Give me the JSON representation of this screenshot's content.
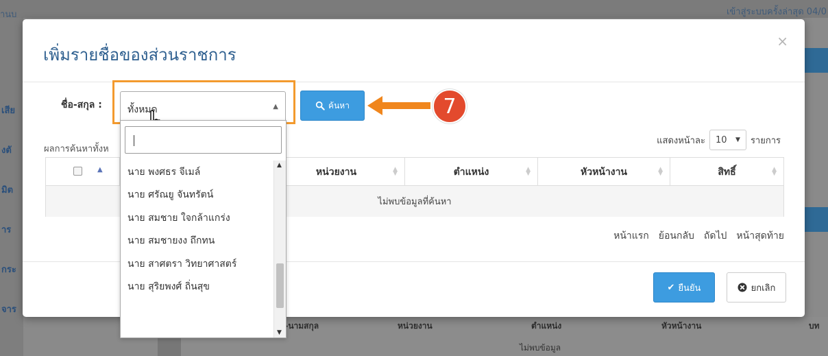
{
  "background": {
    "top_left_text": "านบ",
    "top_right_text": "เข้าสู่ระบบครั้งล่าสุด 04/0",
    "side_items": [
      "เสีย",
      "งตั",
      "มิต",
      "าร",
      "กระ",
      "จาร"
    ],
    "table_headers": [
      "ชื่อ-นามสกุล",
      "หน่วยงาน",
      "ตำแหน่ง",
      "หัวหน้างาน",
      "บท"
    ],
    "empty_text": "ไม่พบข้อมูล"
  },
  "modal": {
    "title": "เพิ่มรายชื่อของส่วนราชการ",
    "close": "×",
    "search_label": "ชื่อ-สกุล :",
    "select_value": "ทั้งหมด",
    "search_button": "ค้นหา",
    "step_number": "7",
    "results_label": "ผลการค้นหาทั้งห",
    "page_size_label": "แสดงหน้าละ",
    "page_size_value": "10",
    "page_size_suffix": "รายการ",
    "table": {
      "headers": [
        "หน่วยงาน",
        "ตำแหน่ง",
        "หัวหน้างาน",
        "สิทธิ์"
      ],
      "empty_text": "ไม่พบข้อมูลที่ค้นหา"
    },
    "pager": [
      "หน้าแรก",
      "ย้อนกลับ",
      "ถัดไป",
      "หน้าสุดท้าย"
    ],
    "confirm_button": "ยืนยัน",
    "cancel_button": "ยกเลิก"
  },
  "dropdown": {
    "search_value": "",
    "options": [
      "นาย พงศธร จีเมล์",
      "นาย ศรัณยู จันทรัตน์",
      "นาย สมชาย ใจกล้าแกร่ง",
      "นาย สมชายงง ถึกทน",
      "นาย สาศตรา วิทยาศาสตร์",
      "นาย สุริยพงศ์ ถิ่นสุข"
    ]
  },
  "colors": {
    "title": "#2e5f8f",
    "primary": "#3d9ce0",
    "highlight": "#f39a2e",
    "step_badge": "#e34a2d"
  }
}
